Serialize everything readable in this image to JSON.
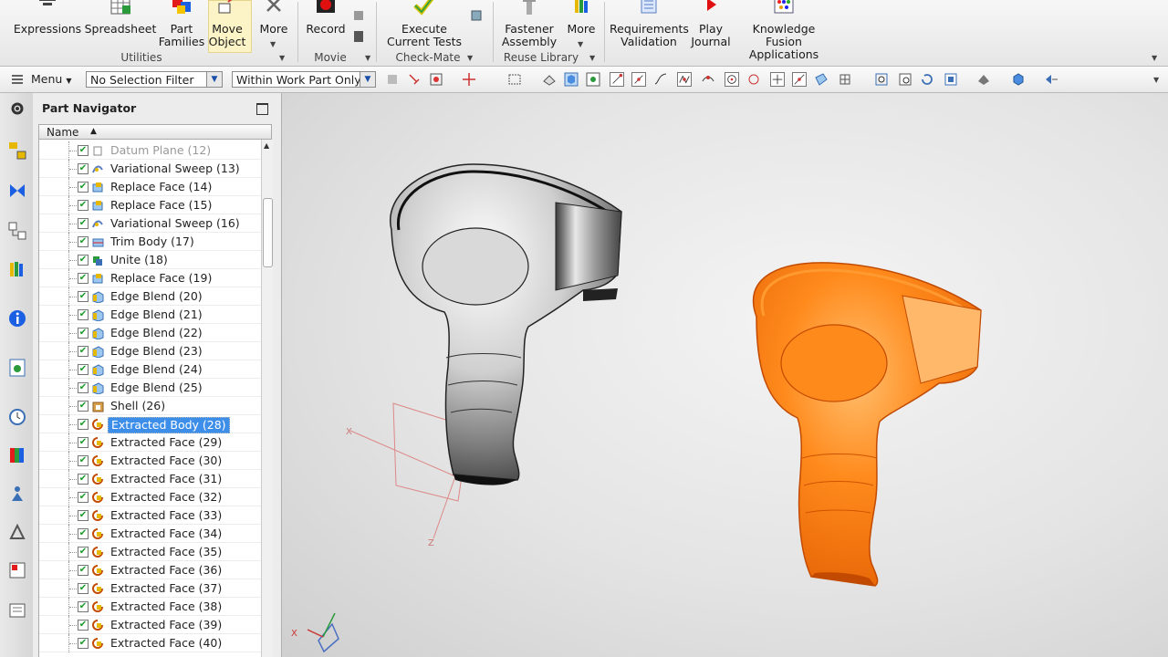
{
  "ribbon": {
    "buttons": [
      {
        "id": "expressions",
        "label": "Expressions"
      },
      {
        "id": "spreadsheet",
        "label": "Spreadsheet"
      },
      {
        "id": "part_families",
        "label": "Part\nFamilies"
      },
      {
        "id": "move_object",
        "label": "Move\nObject"
      },
      {
        "id": "more1",
        "label": "More"
      },
      {
        "id": "record",
        "label": "Record"
      },
      {
        "id": "execute_tests",
        "label": "Execute\nCurrent Tests"
      },
      {
        "id": "fastener",
        "label": "Fastener\nAssembly"
      },
      {
        "id": "more2",
        "label": "More"
      },
      {
        "id": "requirements",
        "label": "Requirements\nValidation"
      },
      {
        "id": "play_journal",
        "label": "Play\nJournal"
      },
      {
        "id": "kf_apps",
        "label": "Knowledge Fusion\nApplications"
      }
    ],
    "groups": {
      "utilities": "Utilities",
      "movie": "Movie",
      "checkmate": "Check-Mate",
      "reuse": "Reuse Library"
    }
  },
  "toolbar": {
    "menu_label": "Menu",
    "selection_filter": "No Selection Filter",
    "scope": "Within Work Part Only"
  },
  "navigator": {
    "title": "Part Navigator",
    "column_name": "Name",
    "items": [
      {
        "label": "Datum Plane (12)",
        "icon": "datum-plane-icon",
        "state": "dim"
      },
      {
        "label": "Variational Sweep (13)",
        "icon": "sweep-icon",
        "state": ""
      },
      {
        "label": "Replace Face (14)",
        "icon": "replace-face-icon",
        "state": ""
      },
      {
        "label": "Replace Face (15)",
        "icon": "replace-face-icon",
        "state": ""
      },
      {
        "label": "Variational Sweep (16)",
        "icon": "sweep-icon",
        "state": ""
      },
      {
        "label": "Trim Body (17)",
        "icon": "trim-body-icon",
        "state": ""
      },
      {
        "label": "Unite (18)",
        "icon": "unite-icon",
        "state": ""
      },
      {
        "label": "Replace Face (19)",
        "icon": "replace-face-icon",
        "state": ""
      },
      {
        "label": "Edge Blend (20)",
        "icon": "edge-blend-icon",
        "state": ""
      },
      {
        "label": "Edge Blend (21)",
        "icon": "edge-blend-icon",
        "state": ""
      },
      {
        "label": "Edge Blend (22)",
        "icon": "edge-blend-icon",
        "state": ""
      },
      {
        "label": "Edge Blend (23)",
        "icon": "edge-blend-icon",
        "state": ""
      },
      {
        "label": "Edge Blend (24)",
        "icon": "edge-blend-icon",
        "state": ""
      },
      {
        "label": "Edge Blend (25)",
        "icon": "edge-blend-icon",
        "state": ""
      },
      {
        "label": "Shell (26)",
        "icon": "shell-icon",
        "state": ""
      },
      {
        "label": "Extracted Body (28)",
        "icon": "extract-icon",
        "state": "sel"
      },
      {
        "label": "Extracted Face (29)",
        "icon": "extract-icon",
        "state": ""
      },
      {
        "label": "Extracted Face (30)",
        "icon": "extract-icon",
        "state": ""
      },
      {
        "label": "Extracted Face (31)",
        "icon": "extract-icon",
        "state": ""
      },
      {
        "label": "Extracted Face (32)",
        "icon": "extract-icon",
        "state": ""
      },
      {
        "label": "Extracted Face (33)",
        "icon": "extract-icon",
        "state": ""
      },
      {
        "label": "Extracted Face (34)",
        "icon": "extract-icon",
        "state": ""
      },
      {
        "label": "Extracted Face (35)",
        "icon": "extract-icon",
        "state": ""
      },
      {
        "label": "Extracted Face (36)",
        "icon": "extract-icon",
        "state": ""
      },
      {
        "label": "Extracted Face (37)",
        "icon": "extract-icon",
        "state": ""
      },
      {
        "label": "Extracted Face (38)",
        "icon": "extract-icon",
        "state": ""
      },
      {
        "label": "Extracted Face (39)",
        "icon": "extract-icon",
        "state": ""
      },
      {
        "label": "Extracted Face (40)",
        "icon": "extract-icon",
        "state": ""
      }
    ]
  },
  "viewport": {
    "axis_labels": {
      "x": "X",
      "z": "Z"
    },
    "model_color": "#ff7a10",
    "highlight_color": "#3d8ee8"
  }
}
